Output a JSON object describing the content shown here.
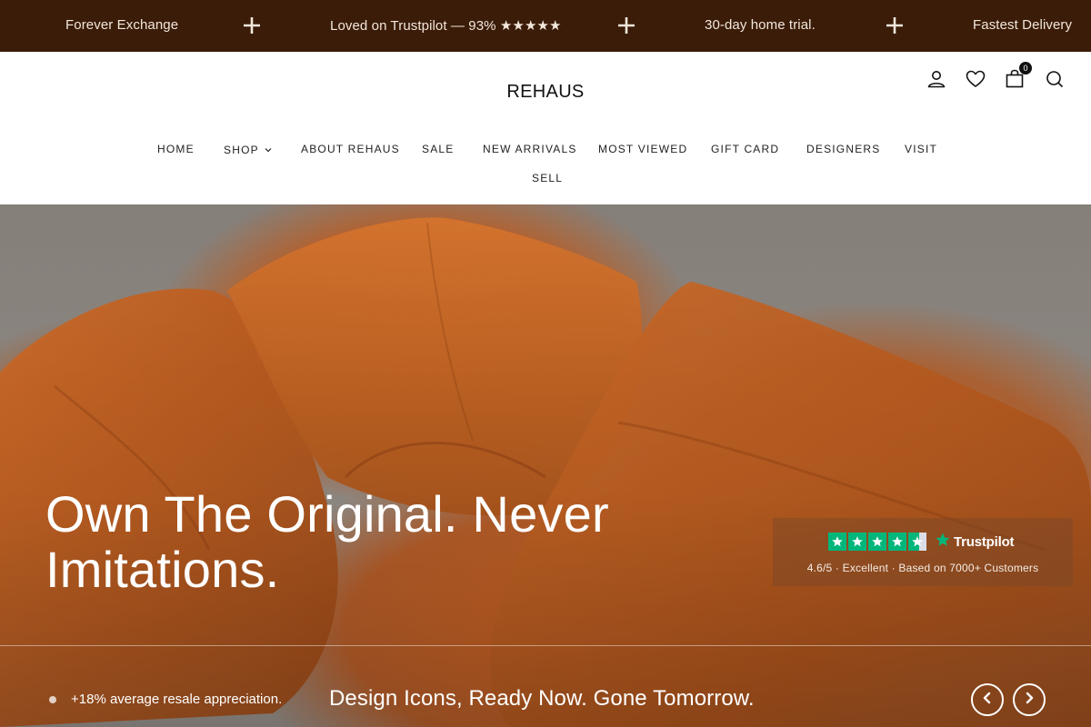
{
  "announcement": {
    "messages": [
      "Forever Exchange",
      "Loved on Trustpilot — 93% ★★★★★",
      "30-day home trial.",
      "Fastest Delivery"
    ],
    "separator_icon": "plus-icon",
    "background": "#3a1c08"
  },
  "header": {
    "logo": "REHAUS",
    "icons": [
      "account-icon",
      "wishlist-heart-icon",
      "cart-bag-icon",
      "search-icon"
    ],
    "cart_count": "0"
  },
  "nav": {
    "items": [
      "HOME",
      "SHOP",
      "ABOUT REHAUS",
      "SALE",
      "NEW ARRIVALS",
      "MOST VIEWED",
      "GIFT CARD",
      "DESIGNERS",
      "VISIT",
      "SELL"
    ]
  },
  "hero": {
    "title": "Own The Original. Never Imitations.",
    "trustpilot": {
      "brand": "Trustpilot",
      "rating_text": "4.6/5 · Excellent · Based on 7000+ Customers",
      "star_color": "#00b67a"
    },
    "stat": "+18% average resale appreciation.",
    "tagline": "Design Icons, Ready Now. Gone Tomorrow.",
    "prev_icon": "chevron-left-icon",
    "next_icon": "chevron-right-icon"
  }
}
